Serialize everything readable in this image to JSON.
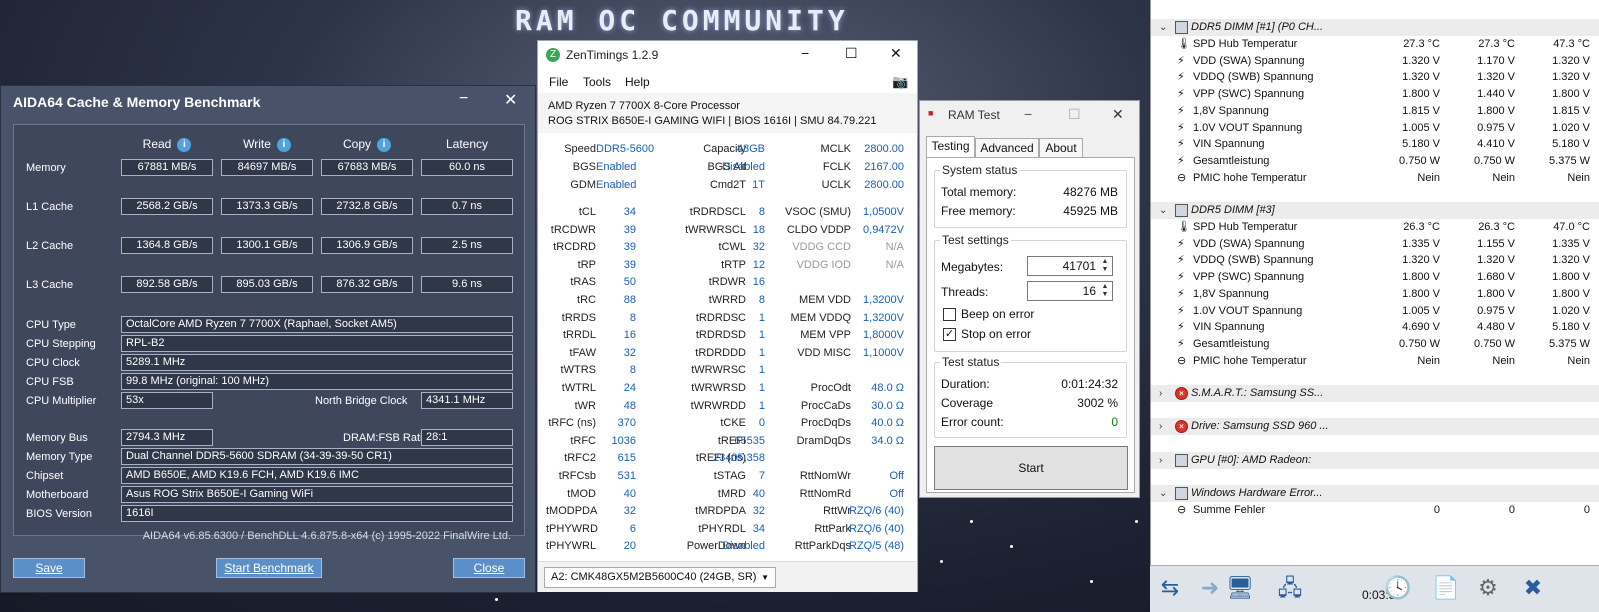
{
  "desktop": {
    "banner": "RAM OC COMMUNITY"
  },
  "aida": {
    "title": "AIDA64 Cache & Memory Benchmark",
    "minimize": "−",
    "close": "✕",
    "headers": {
      "read": "Read",
      "write": "Write",
      "copy": "Copy",
      "latency": "Latency"
    },
    "rows": [
      {
        "label": "Memory",
        "read": "67881 MB/s",
        "write": "84697 MB/s",
        "copy": "67683 MB/s",
        "latency": "60.0 ns"
      },
      {
        "label": "L1 Cache",
        "read": "2568.2 GB/s",
        "write": "1373.3 GB/s",
        "copy": "2732.8 GB/s",
        "latency": "0.7 ns"
      },
      {
        "label": "L2 Cache",
        "read": "1364.8 GB/s",
        "write": "1300.1 GB/s",
        "copy": "1306.9 GB/s",
        "latency": "2.5 ns"
      },
      {
        "label": "L3 Cache",
        "read": "892.58 GB/s",
        "write": "895.03 GB/s",
        "copy": "876.32 GB/s",
        "latency": "9.6 ns"
      }
    ],
    "cpu_type_label": "CPU Type",
    "cpu_type": "OctalCore AMD Ryzen 7 7700X  (Raphael, Socket AM5)",
    "cpu_stepping_label": "CPU Stepping",
    "cpu_stepping": "RPL-B2",
    "cpu_clock_label": "CPU Clock",
    "cpu_clock": "5289.1 MHz",
    "cpu_fsb_label": "CPU FSB",
    "cpu_fsb": "99.8 MHz  (original: 100 MHz)",
    "cpu_mult_label": "CPU Multiplier",
    "cpu_mult": "53x",
    "nb_clock_label": "North Bridge Clock",
    "nb_clock": "4341.1 MHz",
    "mem_bus_label": "Memory Bus",
    "mem_bus": "2794.3 MHz",
    "dram_fsb_label": "DRAM:FSB Ratio",
    "dram_fsb": "28:1",
    "mem_type_label": "Memory Type",
    "mem_type": "Dual Channel DDR5-5600 SDRAM  (34-39-39-50 CR1)",
    "chipset_label": "Chipset",
    "chipset": "AMD B650E, AMD K19.6 FCH, AMD K19.6 IMC",
    "motherboard_label": "Motherboard",
    "motherboard": "Asus ROG Strix B650E-I Gaming WiFi",
    "bios_label": "BIOS Version",
    "bios": "1616I",
    "footer": "AIDA64 v6.85.6300 / BenchDLL 4.6.875.8-x64  (c) 1995-2022 FinalWire Ltd.",
    "btn_save": "Save",
    "btn_start": "Start Benchmark",
    "btn_close": "Close"
  },
  "zen": {
    "title": "ZenTimings 1.2.9",
    "menu": {
      "file": "File",
      "tools": "Tools",
      "help": "Help"
    },
    "cpu": "AMD Ryzen 7 7700X 8-Core Processor",
    "board": "ROG STRIX B650E-I GAMING WIFI | BIOS 1616I | SMU 84.79.221",
    "top": [
      [
        "Speed",
        "DDR5-5600",
        "Capacity",
        "48GB",
        "MCLK",
        "2800.00"
      ],
      [
        "BGS",
        "Enabled",
        "BGS Alt",
        "Disabled",
        "FCLK",
        "2167.00"
      ],
      [
        "GDM",
        "Enabled",
        "Cmd2T",
        "1T",
        "UCLK",
        "2800.00"
      ]
    ],
    "timings": [
      [
        "tCL",
        "34",
        "tRDRDSCL",
        "8",
        "VSOC (SMU)",
        "1,0500V"
      ],
      [
        "tRCDWR",
        "39",
        "tWRWRSCL",
        "18",
        "CLDO VDDP",
        "0,9472V"
      ],
      [
        "tRCDRD",
        "39",
        "tCWL",
        "32",
        "VDDG CCD",
        "N/A"
      ],
      [
        "tRP",
        "39",
        "tRTP",
        "12",
        "VDDG IOD",
        "N/A"
      ],
      [
        "tRAS",
        "50",
        "tRDWR",
        "16",
        "",
        ""
      ],
      [
        "tRC",
        "88",
        "tWRRD",
        "8",
        "MEM VDD",
        "1,3200V"
      ],
      [
        "tRRDS",
        "8",
        "tRDRDSC",
        "1",
        "MEM VDDQ",
        "1,3200V"
      ],
      [
        "tRRDL",
        "16",
        "tRDRDSD",
        "1",
        "MEM VPP",
        "1,8000V"
      ],
      [
        "tFAW",
        "32",
        "tRDRDDD",
        "1",
        "VDD MISC",
        "1,1000V"
      ],
      [
        "tWTRS",
        "8",
        "tWRWRSC",
        "1",
        "",
        ""
      ],
      [
        "tWTRL",
        "24",
        "tWRWRSD",
        "1",
        "ProcOdt",
        "48.0 Ω"
      ],
      [
        "tWR",
        "48",
        "tWRWRDD",
        "1",
        "ProcCaDs",
        "30.0 Ω"
      ],
      [
        "tRFC (ns)",
        "370",
        "tCKE",
        "0",
        "ProcDqDs",
        "40.0 Ω"
      ],
      [
        "tRFC",
        "1036",
        "tREFI",
        "65535",
        "DramDqDs",
        "34.0 Ω"
      ],
      [
        "tRFC2",
        "615",
        "tREFI (ns)",
        "23405,358",
        "",
        ""
      ],
      [
        "tRFCsb",
        "531",
        "tSTAG",
        "7",
        "RttNomWr",
        "Off"
      ],
      [
        "tMOD",
        "40",
        "tMRD",
        "40",
        "RttNomRd",
        "Off"
      ],
      [
        "tMODPDA",
        "32",
        "tMRDPDA",
        "32",
        "RttWr",
        "RZQ/6 (40)"
      ],
      [
        "tPHYWRD",
        "6",
        "tPHYRDL",
        "34",
        "RttPark",
        "RZQ/6 (40)"
      ],
      [
        "tPHYWRL",
        "20",
        "PowerDown",
        "Disabled",
        "RttParkDqs",
        "RZQ/5 (48)"
      ]
    ],
    "module": "A2: CMK48GX5M2B5600C40 (24GB, SR)"
  },
  "ramtest": {
    "title": "RAM Test",
    "tabs": [
      "Testing",
      "Advanced",
      "About"
    ],
    "system_status": "System status",
    "total_label": "Total memory:",
    "total": "48276 MB",
    "free_label": "Free memory:",
    "free": "45925 MB",
    "settings": "Test settings",
    "mb_label": "Megabytes:",
    "mb": "41701",
    "threads_label": "Threads:",
    "threads": "16",
    "beep_label": "Beep on error",
    "stop_label": "Stop on error",
    "test_status": "Test status",
    "duration_label": "Duration:",
    "duration": "0:01:24:32",
    "coverage_label": "Coverage",
    "coverage": "3002 %",
    "errors_label": "Error count:",
    "errors": "0",
    "start": "Start"
  },
  "hwinfo": {
    "dimm1": {
      "title": "DDR5 DIMM [#1] (P0 CH...",
      "rows": [
        [
          "SPD Hub Temperatur",
          "27.3 °C",
          "27.3 °C",
          "47.3 °C"
        ],
        [
          "VDD (SWA) Spannung",
          "1.320 V",
          "1.170 V",
          "1.320 V"
        ],
        [
          "VDDQ (SWB) Spannung",
          "1.320 V",
          "1.320 V",
          "1.320 V"
        ],
        [
          "VPP (SWC) Spannung",
          "1.800 V",
          "1.440 V",
          "1.800 V"
        ],
        [
          "1,8V Spannung",
          "1.815 V",
          "1.800 V",
          "1.815 V"
        ],
        [
          "1.0V VOUT Spannung",
          "1.005 V",
          "0.975 V",
          "1.020 V"
        ],
        [
          "VIN Spannung",
          "5.180 V",
          "4.410 V",
          "5.180 V"
        ],
        [
          "Gesamtleistung",
          "0.750 W",
          "0.750 W",
          "5.375 W"
        ],
        [
          "PMIC hohe Temperatur",
          "Nein",
          "Nein",
          "Nein"
        ]
      ]
    },
    "dimm3": {
      "title": "DDR5 DIMM [#3]",
      "rows": [
        [
          "SPD Hub Temperatur",
          "26.3 °C",
          "26.3 °C",
          "47.0 °C"
        ],
        [
          "VDD (SWA) Spannung",
          "1.335 V",
          "1.155 V",
          "1.335 V"
        ],
        [
          "VDDQ (SWB) Spannung",
          "1.320 V",
          "1.320 V",
          "1.320 V"
        ],
        [
          "VPP (SWC) Spannung",
          "1.800 V",
          "1.680 V",
          "1.800 V"
        ],
        [
          "1,8V Spannung",
          "1.800 V",
          "1.800 V",
          "1.800 V"
        ],
        [
          "1.0V VOUT Spannung",
          "1.005 V",
          "0.975 V",
          "1.020 V"
        ],
        [
          "VIN Spannung",
          "4.690 V",
          "4.480 V",
          "5.180 V"
        ],
        [
          "Gesamtleistung",
          "0.750 W",
          "0.750 W",
          "5.375 W"
        ],
        [
          "PMIC hohe Temperatur",
          "Nein",
          "Nein",
          "Nein"
        ]
      ]
    },
    "smart": "S.M.A.R.T.: Samsung SS...",
    "drive": "Drive: Samsung SSD 960 ...",
    "gpu": "GPU [#0]: AMD Radeon:",
    "whea": "Windows Hardware Error...",
    "whea_row": [
      "Summe Fehler",
      "0",
      "0",
      "0"
    ],
    "timer": "0:03:31"
  }
}
